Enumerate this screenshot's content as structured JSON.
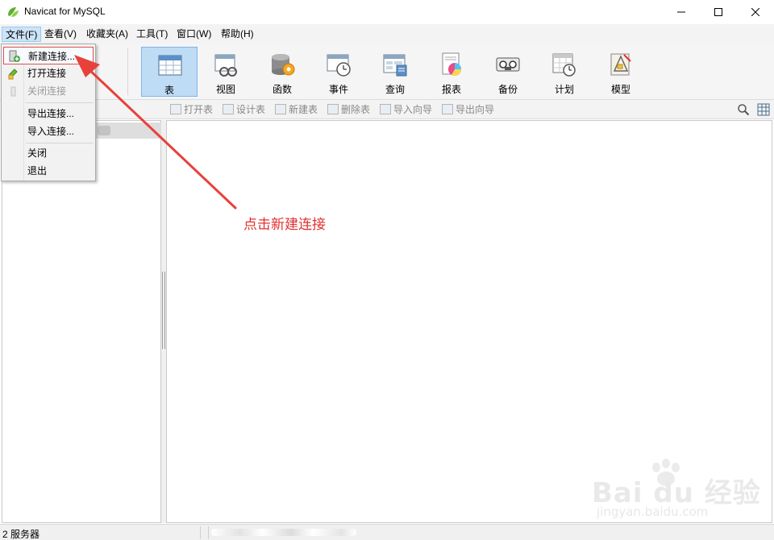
{
  "window": {
    "title": "Navicat for MySQL",
    "min_icon": "minimize-icon",
    "max_icon": "maximize-icon",
    "close_icon": "close-icon"
  },
  "menu": [
    {
      "label": "文件(F)",
      "active": true
    },
    {
      "label": "查看(V)"
    },
    {
      "label": "收藏夹(A)"
    },
    {
      "label": "工具(T)"
    },
    {
      "label": "窗口(W)"
    },
    {
      "label": "帮助(H)"
    }
  ],
  "file_menu": {
    "items": [
      {
        "label": "新建连接...",
        "icon": "new-connection-icon",
        "highlighted": true
      },
      {
        "label": "打开连接",
        "icon": "open-connection-icon"
      },
      {
        "label": "关闭连接",
        "icon": "close-connection-icon",
        "disabled": true
      },
      {
        "label": "导出连接..."
      },
      {
        "label": "导入连接..."
      },
      {
        "label": "关闭"
      },
      {
        "label": "退出"
      }
    ]
  },
  "toolbar": [
    {
      "label": "表",
      "icon": "table-icon",
      "active": true
    },
    {
      "label": "视图",
      "icon": "view-icon"
    },
    {
      "label": "函数",
      "icon": "function-icon"
    },
    {
      "label": "事件",
      "icon": "event-icon"
    },
    {
      "label": "查询",
      "icon": "query-icon"
    },
    {
      "label": "报表",
      "icon": "report-icon"
    },
    {
      "label": "备份",
      "icon": "backup-icon"
    },
    {
      "label": "计划",
      "icon": "schedule-icon"
    },
    {
      "label": "模型",
      "icon": "model-icon"
    }
  ],
  "subtoolbar": [
    {
      "label": "打开表",
      "icon": "open-table-icon"
    },
    {
      "label": "设计表",
      "icon": "design-table-icon"
    },
    {
      "label": "新建表",
      "icon": "new-table-icon"
    },
    {
      "label": "删除表",
      "icon": "delete-table-icon"
    },
    {
      "label": "导入向导",
      "icon": "import-wizard-icon"
    },
    {
      "label": "导出向导",
      "icon": "export-wizard-icon"
    }
  ],
  "status": {
    "servers": "2 服务器"
  },
  "annotation": {
    "text": "点击新建连接",
    "color": "#e0302f"
  },
  "watermark": {
    "brand": "Bai du 经验",
    "url": "jingyan.baidu.com"
  },
  "colors": {
    "active_tool": "#bfdcf5",
    "menu_active": "#cce4f7",
    "highlight_border": "#e35050"
  }
}
